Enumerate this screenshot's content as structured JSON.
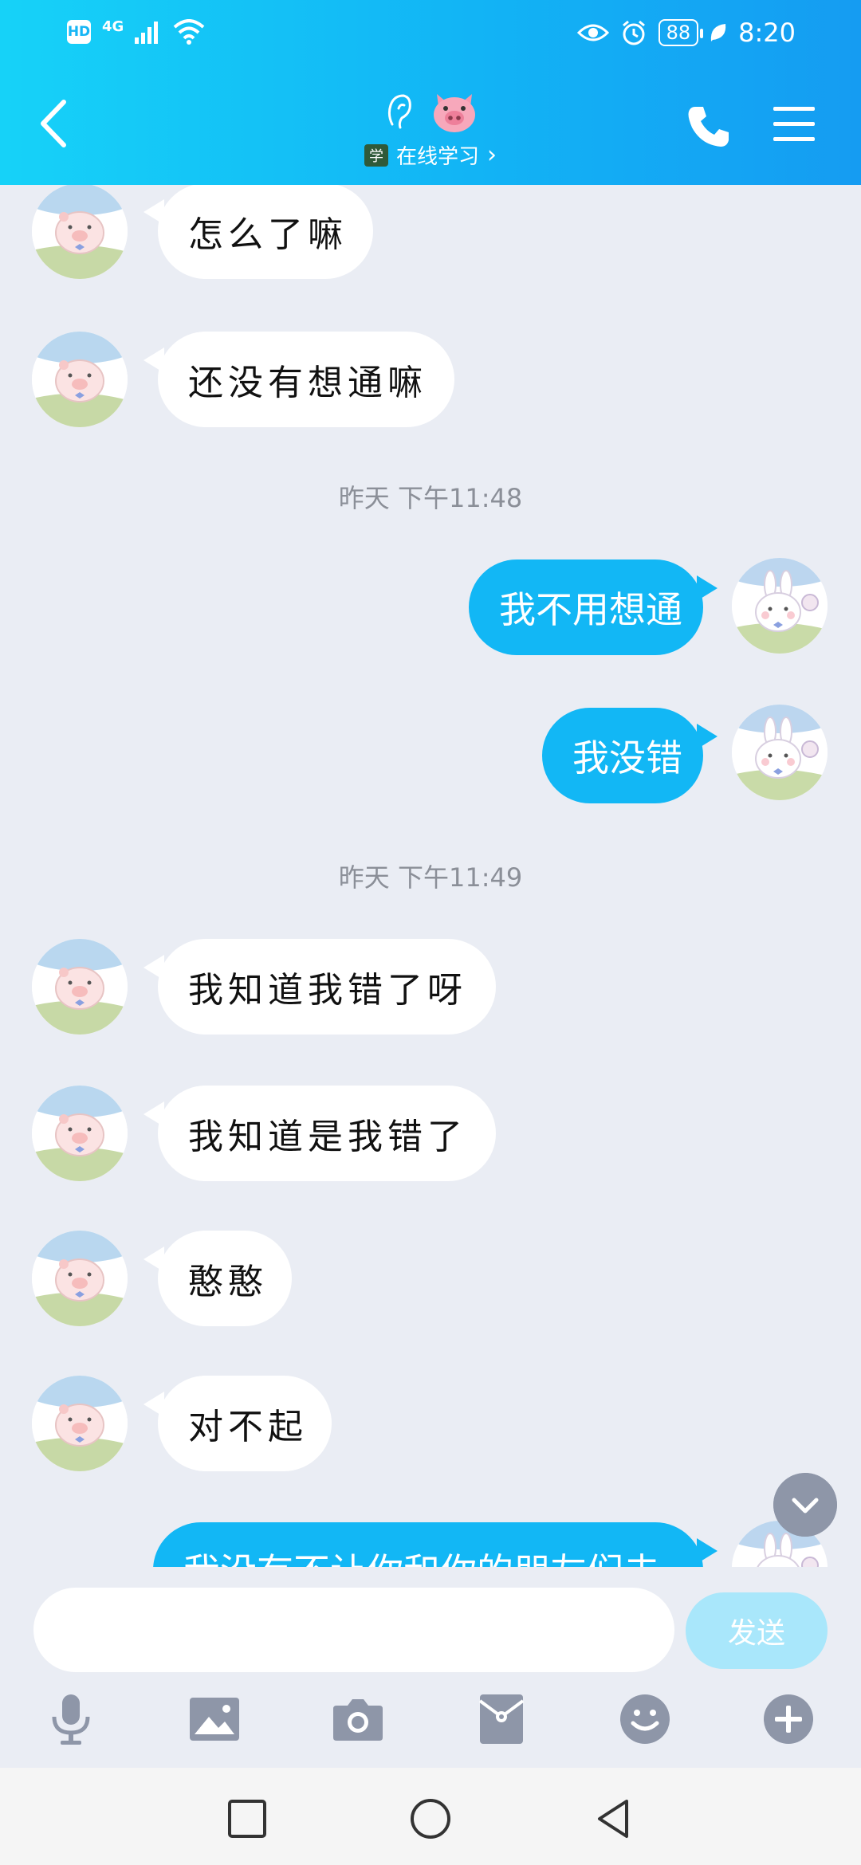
{
  "status_bar": {
    "hd": "HD",
    "network": "4G",
    "battery": "88",
    "time": "8:20"
  },
  "header": {
    "subtitle": "在线学习",
    "subtitle_icon_text": "学",
    "chevron": "›"
  },
  "messages": [
    {
      "type": "in",
      "text": "怎么了嘛"
    },
    {
      "type": "in",
      "text": "还没有想通嘛"
    },
    {
      "type": "time",
      "text": "昨天 下午11:48"
    },
    {
      "type": "out",
      "text": "我不用想通"
    },
    {
      "type": "out",
      "text": "我没错"
    },
    {
      "type": "time",
      "text": "昨天 下午11:49"
    },
    {
      "type": "in",
      "text": "我知道我错了呀"
    },
    {
      "type": "in",
      "text": "我知道是我错了"
    },
    {
      "type": "in",
      "text": "憨憨"
    },
    {
      "type": "in",
      "text": "对不起"
    },
    {
      "type": "out",
      "text": "我没有不让你和你的朋友们去"
    }
  ],
  "input": {
    "placeholder": "",
    "send_label": "发送"
  },
  "colors": {
    "accent": "#12b7f5",
    "header_start": "#16d2f8",
    "header_end": "#159cf2",
    "background": "#eaedf4",
    "send_disabled": "#a9e7fb"
  },
  "icons": {
    "back": "chevron-left-icon",
    "ear": "ear-icon",
    "pig": "pig-face-icon",
    "call": "phone-icon",
    "menu": "menu-icon",
    "toolbar": [
      "microphone-icon",
      "image-icon",
      "camera-icon",
      "red-packet-icon",
      "emoji-icon",
      "plus-icon"
    ],
    "system_nav": [
      "recents-icon",
      "home-icon",
      "back-icon"
    ]
  }
}
